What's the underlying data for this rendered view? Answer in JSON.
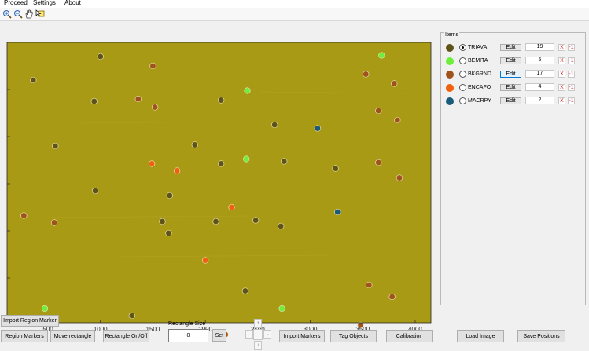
{
  "menu": {
    "items": [
      "Proceed",
      "Settings",
      "About"
    ]
  },
  "toolbar": {
    "icons": [
      "zoom-in-icon",
      "zoom-out-icon",
      "pan-hand-icon",
      "data-cursor-icon"
    ]
  },
  "plot": {
    "background_color": "#a99a16",
    "x_ticks": [
      "500",
      "1000",
      "1500",
      "2000",
      "2500",
      "3000",
      "3500",
      "4000"
    ],
    "xlim": [
      110,
      4150
    ],
    "ylim": [
      2380,
      0
    ]
  },
  "categories": [
    {
      "name": "TRIAVA",
      "color": "#5e5418",
      "count": "19",
      "selected": true,
      "edit_focused": false
    },
    {
      "name": "BEMITA",
      "color": "#6ef03a",
      "count": "5",
      "selected": false,
      "edit_focused": false
    },
    {
      "name": "BKGRND",
      "color": "#a0521c",
      "count": "17",
      "selected": false,
      "edit_focused": true
    },
    {
      "name": "ENCAFO",
      "color": "#f06010",
      "count": "4",
      "selected": false,
      "edit_focused": false
    },
    {
      "name": "MACRPY",
      "color": "#1a5a7a",
      "count": "2",
      "selected": false,
      "edit_focused": false
    }
  ],
  "markers": [
    {
      "cat": 0,
      "x": 1000,
      "y": 120
    },
    {
      "cat": 0,
      "x": 360,
      "y": 320
    },
    {
      "cat": 0,
      "x": 940,
      "y": 500
    },
    {
      "cat": 0,
      "x": 2150,
      "y": 490
    },
    {
      "cat": 0,
      "x": 2660,
      "y": 700
    },
    {
      "cat": 0,
      "x": 570,
      "y": 880
    },
    {
      "cat": 0,
      "x": 1900,
      "y": 870
    },
    {
      "cat": 0,
      "x": 2150,
      "y": 1030
    },
    {
      "cat": 0,
      "x": 2750,
      "y": 1010
    },
    {
      "cat": 0,
      "x": 3240,
      "y": 1070
    },
    {
      "cat": 0,
      "x": 950,
      "y": 1260
    },
    {
      "cat": 0,
      "x": 1660,
      "y": 1300
    },
    {
      "cat": 0,
      "x": 1590,
      "y": 1520
    },
    {
      "cat": 0,
      "x": 2100,
      "y": 1520
    },
    {
      "cat": 0,
      "x": 2480,
      "y": 1510
    },
    {
      "cat": 0,
      "x": 2720,
      "y": 1560
    },
    {
      "cat": 0,
      "x": 1650,
      "y": 1620
    },
    {
      "cat": 0,
      "x": 2380,
      "y": 2110
    },
    {
      "cat": 0,
      "x": 1300,
      "y": 2320
    },
    {
      "cat": 1,
      "x": 3680,
      "y": 110
    },
    {
      "cat": 1,
      "x": 2400,
      "y": 410
    },
    {
      "cat": 1,
      "x": 2390,
      "y": 990
    },
    {
      "cat": 1,
      "x": 470,
      "y": 2260
    },
    {
      "cat": 1,
      "x": 2730,
      "y": 2260
    },
    {
      "cat": 2,
      "x": 1500,
      "y": 200
    },
    {
      "cat": 2,
      "x": 3530,
      "y": 270
    },
    {
      "cat": 2,
      "x": 3800,
      "y": 350
    },
    {
      "cat": 2,
      "x": 1360,
      "y": 480
    },
    {
      "cat": 2,
      "x": 1520,
      "y": 550
    },
    {
      "cat": 2,
      "x": 3650,
      "y": 580
    },
    {
      "cat": 2,
      "x": 3830,
      "y": 660
    },
    {
      "cat": 2,
      "x": 3650,
      "y": 1020
    },
    {
      "cat": 2,
      "x": 3850,
      "y": 1150
    },
    {
      "cat": 2,
      "x": 270,
      "y": 1470
    },
    {
      "cat": 2,
      "x": 560,
      "y": 1530
    },
    {
      "cat": 2,
      "x": 3560,
      "y": 2060
    },
    {
      "cat": 2,
      "x": 3780,
      "y": 2160
    },
    {
      "cat": 2,
      "x": 3480,
      "y": 2400
    },
    {
      "cat": 2,
      "x": 3770,
      "y": 2470
    },
    {
      "cat": 2,
      "x": 1870,
      "y": 2470
    },
    {
      "cat": 2,
      "x": 2190,
      "y": 2480
    },
    {
      "cat": 3,
      "x": 1490,
      "y": 1030
    },
    {
      "cat": 3,
      "x": 1730,
      "y": 1090
    },
    {
      "cat": 3,
      "x": 2250,
      "y": 1400
    },
    {
      "cat": 3,
      "x": 2000,
      "y": 1850
    },
    {
      "cat": 4,
      "x": 3070,
      "y": 730
    },
    {
      "cat": 4,
      "x": 3260,
      "y": 1440
    }
  ],
  "panel": {
    "items_title": "Items",
    "edit_label": "Edit",
    "delete_label": "X",
    "minus_label": "-1"
  },
  "controls": {
    "import_region_marker": "Import Region Marker",
    "region_markers": "Region Markers",
    "move_rectangle": "Move rectangle",
    "rectangle_toggle": "Rectangle On/Off",
    "rectangle_size_label": "Rectangle Size",
    "rectangle_size_value": "0",
    "set": "Set",
    "nudge_up": "↑",
    "nudge_left": "←",
    "nudge_right": "→",
    "nudge_down": "↓",
    "import_markers": "Import Markers",
    "tag_objects": "Tag Objects",
    "calibration": "Calibration",
    "load_image": "Load Image",
    "save_positions": "Save Positions"
  }
}
